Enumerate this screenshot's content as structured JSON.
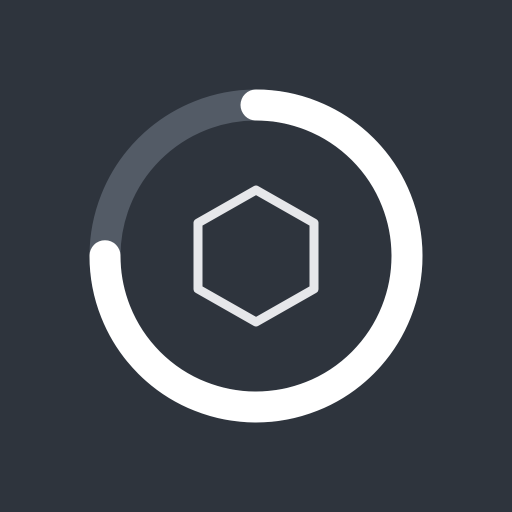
{
  "progress": {
    "value": 0.75,
    "track_color": "#535b66",
    "fill_color": "#ffffff",
    "background_color": "#2e343d",
    "center_icon": "hexagon-outline-icon",
    "icon_color": "#e6e7ea"
  }
}
